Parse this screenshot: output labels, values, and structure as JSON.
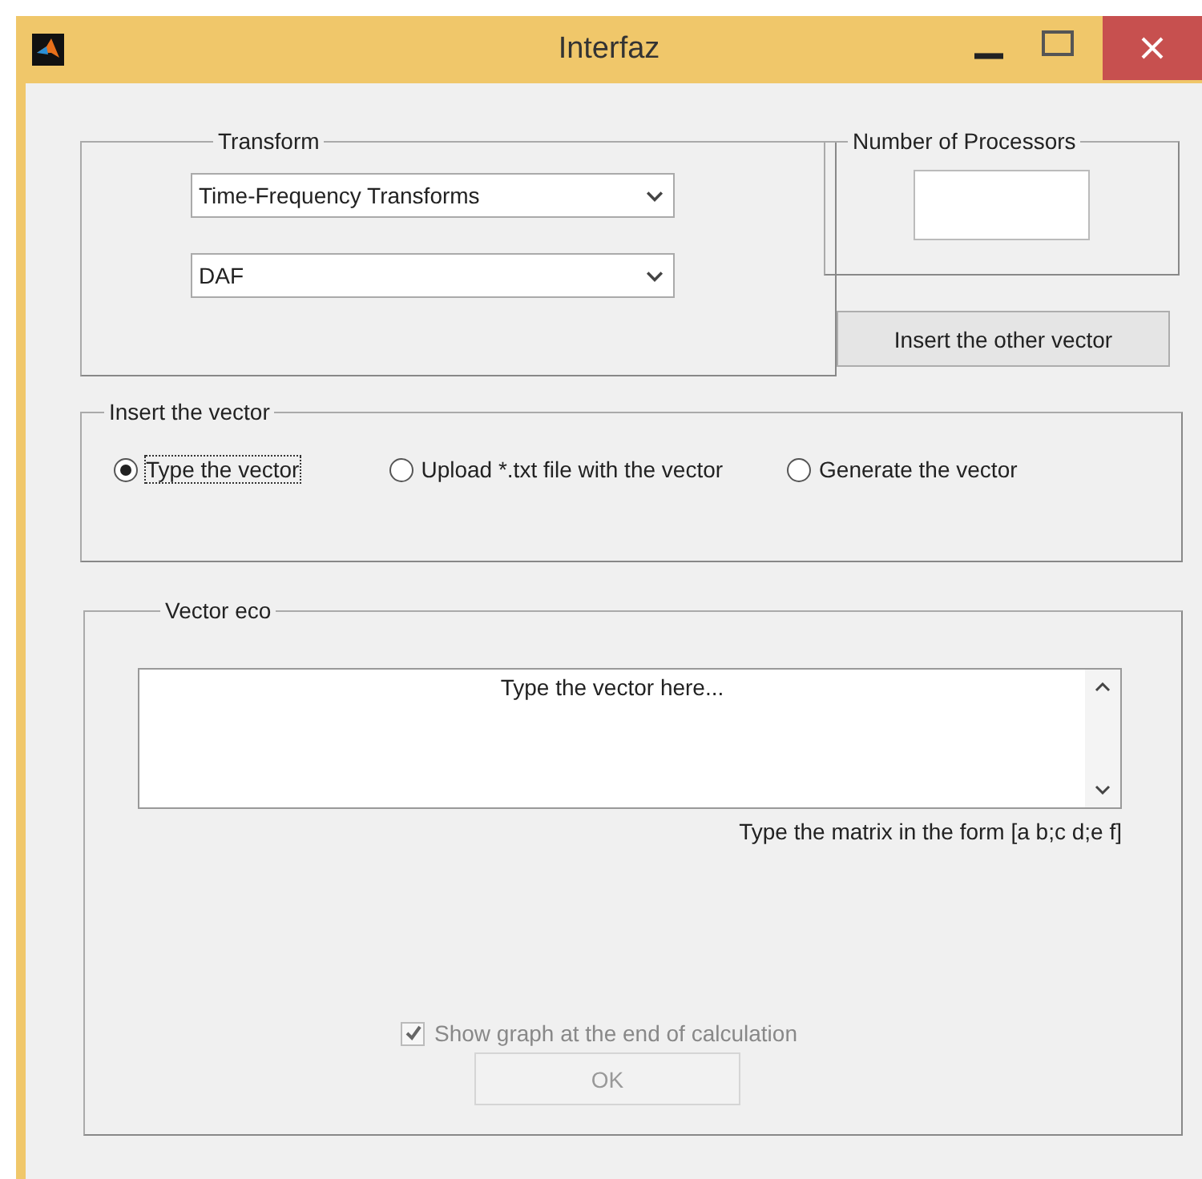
{
  "window": {
    "title": "Interfaz"
  },
  "transform": {
    "label": "Transform",
    "dropdowns": [
      {
        "value": "Time-Frequency Transforms"
      },
      {
        "value": "DAF"
      }
    ]
  },
  "processors": {
    "label": "Number of Processors"
  },
  "other_vector_button": {
    "label": "Insert the other vector"
  },
  "insert_vector": {
    "label": "Insert the vector",
    "options": [
      {
        "label": "Type the vector",
        "selected": true
      },
      {
        "label": "Upload *.txt file with the vector",
        "selected": false
      },
      {
        "label": "Generate the vector",
        "selected": false
      }
    ]
  },
  "vector_eco": {
    "label": "Vector eco",
    "value": "Type the vector here...",
    "hint": "Type the matrix in the form [a b;c d;e f]",
    "show_graph": {
      "label": "Show graph at the end of calculation",
      "checked": true,
      "disabled": true
    },
    "ok": {
      "label": "OK",
      "disabled": true
    }
  }
}
